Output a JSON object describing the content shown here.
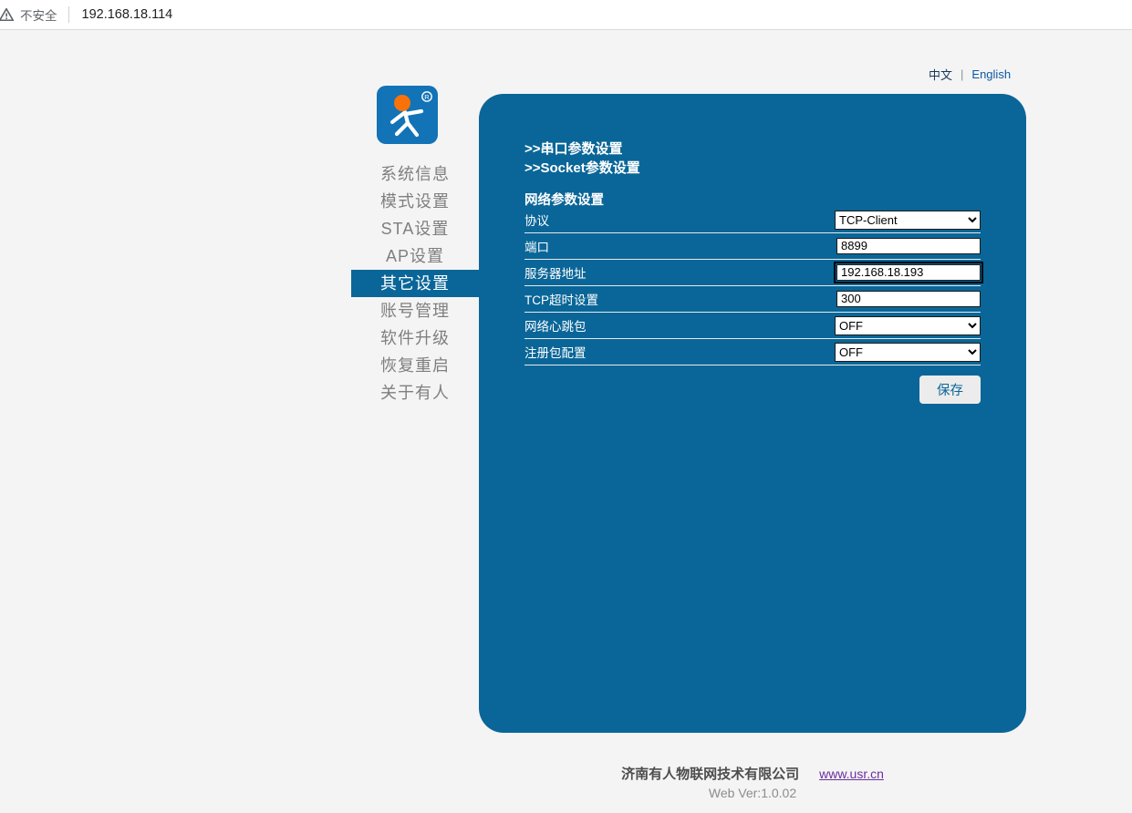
{
  "browser": {
    "security_warning": "不安全",
    "url": "192.168.18.114"
  },
  "language_switch": {
    "chinese": "中文",
    "separator": "|",
    "english": "English"
  },
  "logo": {
    "registered_mark": "R"
  },
  "sidebar": {
    "items": [
      {
        "label": "系统信息",
        "active": false
      },
      {
        "label": "模式设置",
        "active": false
      },
      {
        "label": "STA设置",
        "active": false
      },
      {
        "label": "AP设置",
        "active": false
      },
      {
        "label": "其它设置",
        "active": true
      },
      {
        "label": "账号管理",
        "active": false
      },
      {
        "label": "软件升级",
        "active": false
      },
      {
        "label": "恢复重启",
        "active": false
      },
      {
        "label": "关于有人",
        "active": false
      }
    ]
  },
  "panel": {
    "links": [
      ">>串口参数设置",
      ">>Socket参数设置"
    ],
    "section_title": "网络参数设置",
    "fields": [
      {
        "label": "协议",
        "control": "select",
        "value": "TCP-Client"
      },
      {
        "label": "端口",
        "control": "input",
        "value": "8899"
      },
      {
        "label": "服务器地址",
        "control": "input",
        "value": "192.168.18.193",
        "focused": true
      },
      {
        "label": "TCP超时设置",
        "control": "input",
        "value": "300"
      },
      {
        "label": "网络心跳包",
        "control": "select",
        "value": "OFF"
      },
      {
        "label": "注册包配置",
        "control": "select",
        "value": "OFF"
      }
    ],
    "save_button": "保存"
  },
  "footer": {
    "company": "济南有人物联网技术有限公司",
    "website": "www.usr.cn",
    "version": "Web Ver:1.0.02"
  },
  "colors": {
    "panel_blue": "#0A6698",
    "logo_blue": "#1273B7",
    "logo_orange": "#F97209",
    "page_background": "#F4F4F4",
    "menu_text_gray": "#7F7F7F",
    "link_blue": "#0B5AA5",
    "visited_link_purple": "#6B2FA0"
  }
}
